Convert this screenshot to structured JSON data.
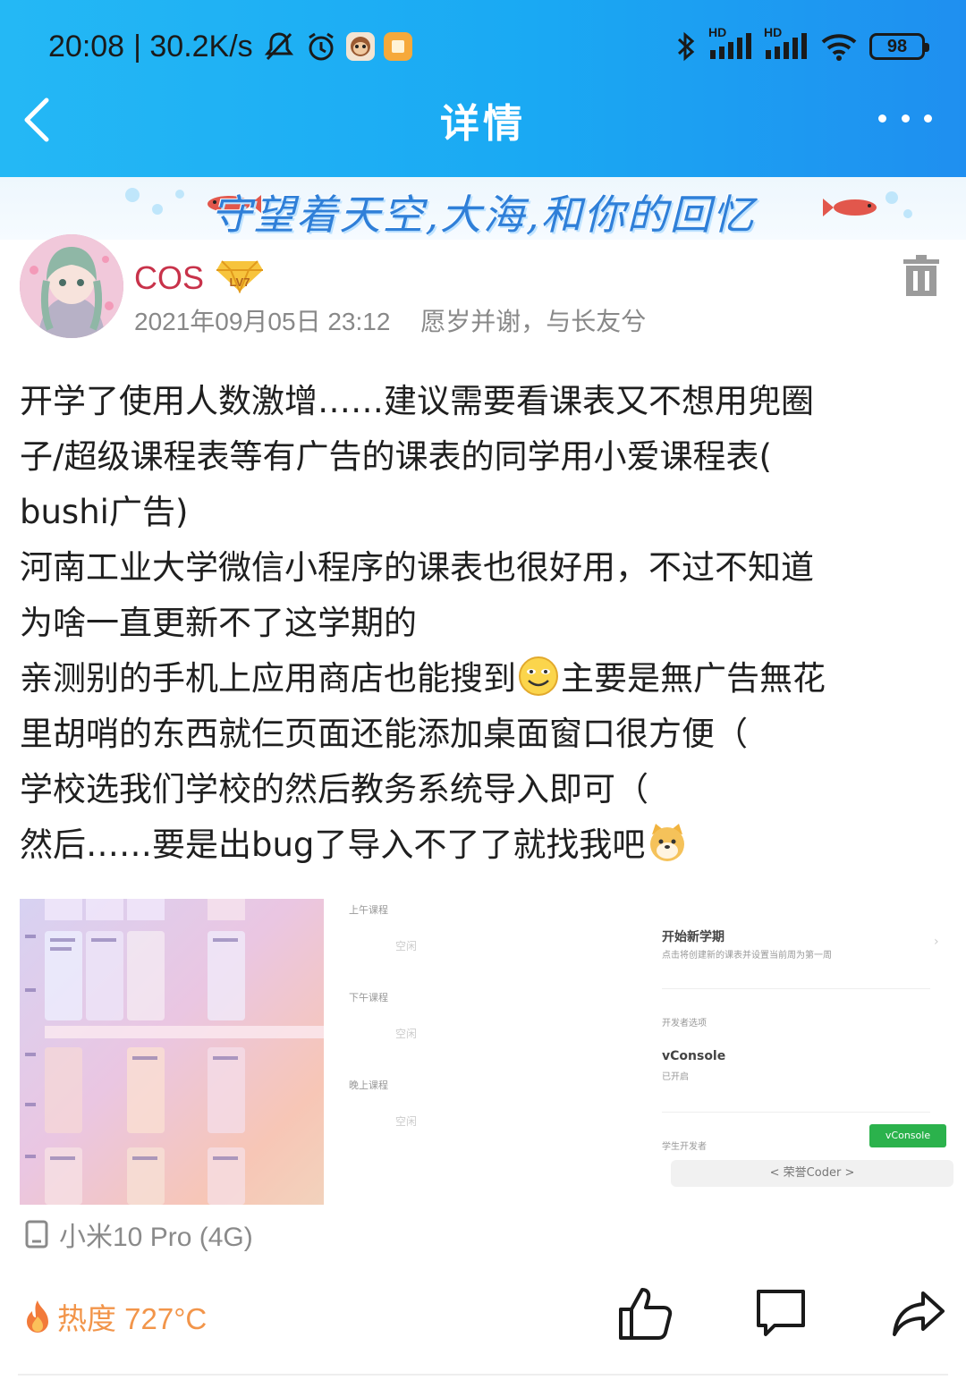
{
  "status_bar": {
    "time": "20:08",
    "net_speed": "| 30.2K/s",
    "signal_label_1": "HD",
    "signal_label_2": "HD",
    "battery": "98"
  },
  "header": {
    "title": "详情"
  },
  "banner": {
    "text": "守望着天空,大海,和你的回忆"
  },
  "post": {
    "author": "COS",
    "level": "LV7",
    "datetime": "2021年09月05日 23:12",
    "signature": "愿岁并谢，与长友兮",
    "lines": {
      "l1": "开学了使用人数激增……建议需要看课表又不想用兜圈",
      "l2": "子/超级课程表等有广告的课表的同学用小爱课程表(",
      "l3": "bushi广告)",
      "l4": "河南工业大学微信小程序的课表也很好用，不过不知道",
      "l5": "为啥一直更新不了这学期的",
      "l6a": "亲测别的手机上应用商店也能搜到",
      "l6b": "主要是無广告無花",
      "l7": "里胡哨的东西就仨页面还能添加桌面窗口很方便（",
      "l8": "学校选我们学校的然后教务系统导入即可（",
      "l9": "然后……要是出bug了导入不了了就找我吧"
    },
    "device": "小米10 Pro (4G)",
    "heat": "热度 727°C"
  },
  "screenshot2": {
    "morning": "上午课程",
    "afternoon": "下午课程",
    "evening": "晚上课程",
    "empty": "空闲"
  },
  "screenshot3": {
    "new_term_title": "开始新学期",
    "new_term_desc": "点击将创建新的课表并设置当前周为第一周",
    "dev_options": "开发者选项",
    "vconsole": "vConsole",
    "vconsole_status": "已开启",
    "vconsole_btn": "vConsole",
    "student_dev": "学生开发者",
    "coder": "< 荣誉Coder >"
  },
  "icons": {
    "back": "chevron-left-icon",
    "more": "more-icon",
    "delete": "trash-icon",
    "device": "phone-icon",
    "heat": "fire-icon",
    "like": "thumbs-up-icon",
    "comment": "comment-icon",
    "share": "share-icon"
  },
  "colors": {
    "header_bg": "#1aa9f3",
    "username": "#c8324a",
    "heat": "#f2954a"
  }
}
